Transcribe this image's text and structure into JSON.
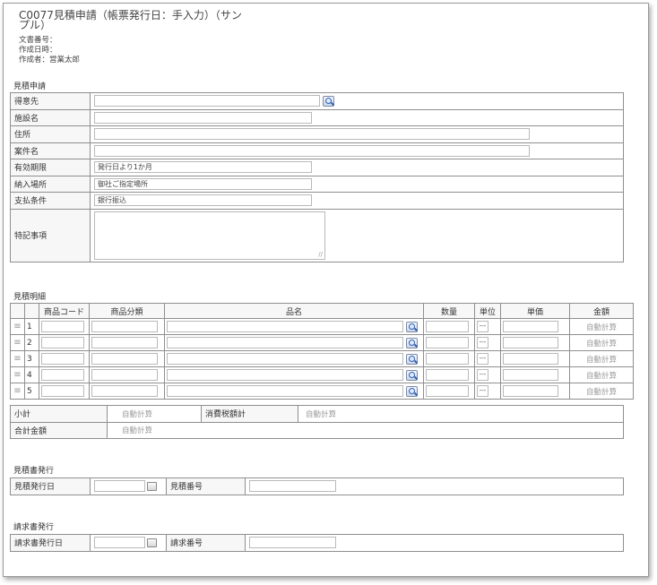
{
  "header": {
    "title": "C0077見積申請（帳票発行日：手入力）（サンプル）",
    "doc_number_label": "文書番号：",
    "created_at_label": "作成日時：",
    "author_label": "作成者：",
    "author_value": "営業太郎"
  },
  "quote_request": {
    "section_title": "見積申請",
    "customer_label": "得意先",
    "facility_label": "施設名",
    "address_label": "住所",
    "project_label": "案件名",
    "validity_label": "有効期限",
    "validity_value": "発行日より1か月",
    "delivery_label": "納入場所",
    "delivery_value": "御社ご指定場所",
    "payment_label": "支払条件",
    "payment_value": "銀行振込",
    "notes_label": "特記事項"
  },
  "details": {
    "section_title": "見積明細",
    "columns": [
      "",
      "",
      "商品コード",
      "商品分類",
      "品名",
      "数量",
      "単位",
      "単価",
      "金額"
    ],
    "rows": [
      {
        "no": "1",
        "unit": "---",
        "amount": "自動計算"
      },
      {
        "no": "2",
        "unit": "---",
        "amount": "自動計算"
      },
      {
        "no": "3",
        "unit": "---",
        "amount": "自動計算"
      },
      {
        "no": "4",
        "unit": "---",
        "amount": "自動計算"
      },
      {
        "no": "5",
        "unit": "---",
        "amount": "自動計算"
      }
    ]
  },
  "totals": {
    "subtotal_label": "小計",
    "subtotal_value": "自動計算",
    "tax_label": "消費税額計",
    "tax_value": "自動計算",
    "total_label": "合計金額",
    "total_value": "自動計算"
  },
  "quote_issue": {
    "section_title": "見積書発行",
    "date_label": "見積発行日",
    "number_label": "見積番号"
  },
  "invoice_issue": {
    "section_title": "請求書発行",
    "date_label": "請求書発行日",
    "number_label": "請求番号"
  },
  "icons": {
    "lookup": "search-icon",
    "calendar": "calendar-icon",
    "drag": "drag-handle-icon"
  }
}
